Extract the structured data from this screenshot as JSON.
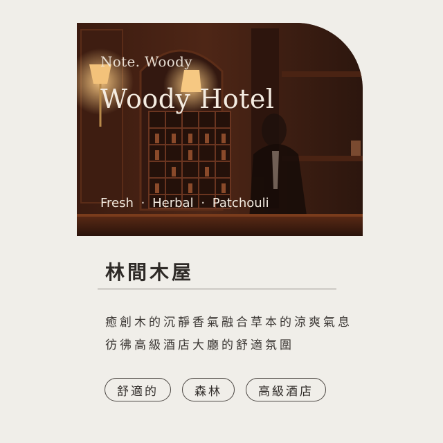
{
  "hero": {
    "subtitle": "Note. Woody",
    "headline": "Woody Hotel",
    "notes": [
      "Fresh",
      "Herbal",
      "Patchouli"
    ],
    "note_separator": "·"
  },
  "product": {
    "title": "林間木屋",
    "description_line1": "癒創木的沉靜香氣融合草本的涼爽氣息",
    "description_line2": "彷彿高級酒店大廳的舒適氛圍"
  },
  "tags": [
    {
      "label": "舒適的"
    },
    {
      "label": "森林"
    },
    {
      "label": "高級酒店"
    }
  ],
  "colors": {
    "background": "#f0eee9",
    "text_dark": "#2e2a27",
    "overlay_text": "#f4ece1"
  }
}
